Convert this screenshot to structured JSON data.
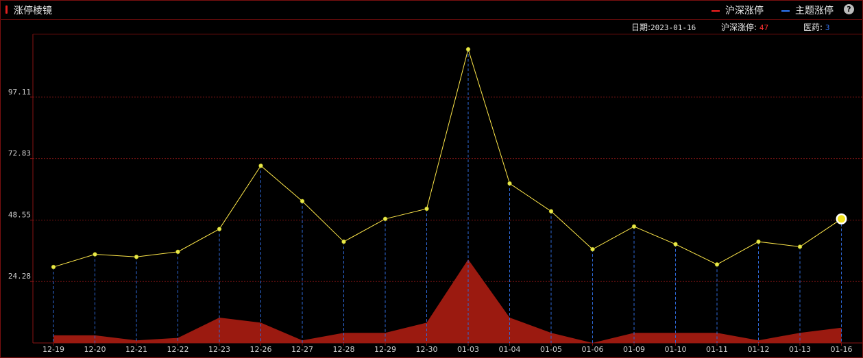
{
  "panel": {
    "title": "涨停棱镜",
    "legend": [
      {
        "label": "沪深涨停",
        "color": "#ff2020"
      },
      {
        "label": "主题涨停",
        "color": "#2f7bff"
      }
    ],
    "help": "?"
  },
  "info": {
    "date_label": "日期:",
    "date_value": "2023-01-16",
    "market_label": "沪深涨停:",
    "market_value": "47",
    "market_color": "#ff3030",
    "theme_label": "医药:",
    "theme_value": "3",
    "theme_color": "#3a7bff"
  },
  "chart_data": {
    "type": "line",
    "categories": [
      "12-19",
      "12-20",
      "12-21",
      "12-22",
      "12-23",
      "12-26",
      "12-27",
      "12-28",
      "12-29",
      "12-30",
      "01-03",
      "01-04",
      "01-05",
      "01-06",
      "01-09",
      "01-10",
      "01-11",
      "01-12",
      "01-13",
      "01-16"
    ],
    "yticks": [
      "97.11",
      "72.83",
      "48.55",
      "24.28"
    ],
    "ylim": [
      0,
      116
    ],
    "grid": true,
    "series": [
      {
        "name": "沪深涨停",
        "color": "#ffe84a",
        "style": "line-with-points",
        "values": [
          30,
          35,
          34,
          36,
          45,
          70,
          56,
          40,
          49,
          53,
          116,
          63,
          52,
          37,
          46,
          39,
          31,
          40,
          38,
          49
        ]
      },
      {
        "name": "主题涨停",
        "color": "#9b1a10",
        "style": "area",
        "values": [
          3,
          3,
          1,
          2,
          10,
          8,
          1,
          4,
          4,
          8,
          33,
          10,
          4,
          0,
          4,
          4,
          4,
          1,
          4,
          6
        ]
      }
    ],
    "highlight_last": true
  }
}
